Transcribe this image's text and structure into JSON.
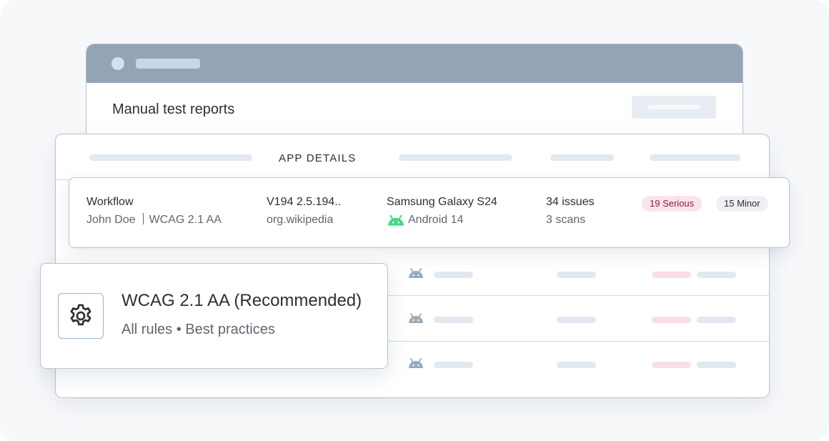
{
  "back_window": {
    "title": "Manual test reports"
  },
  "table": {
    "header_label": "APP DETAILS"
  },
  "highlighted_row": {
    "workflow_title": "Workflow",
    "user": "John Doe",
    "standard": "WCAG 2.1 AA",
    "version": "V194 2.5.194..",
    "package": "org.wikipedia",
    "device": "Samsung Galaxy S24",
    "os": "Android 14",
    "issues": "34 issues",
    "scans": "3 scans",
    "serious_badge": "19 Serious",
    "minor_badge": "15 Minor",
    "os_icon": "android-icon"
  },
  "popup": {
    "title": "WCAG 2.1 AA (Recommended)",
    "subtitle": "All rules • Best practices",
    "icon": "gear-icon"
  },
  "colors": {
    "titlebar": "#93a4b6",
    "android_green": "#3ddc84",
    "android_gray": "#9aaaba",
    "serious_bg": "#fbe3ec",
    "serious_text": "#8d1c4b",
    "minor_bg": "#eef0f3"
  }
}
